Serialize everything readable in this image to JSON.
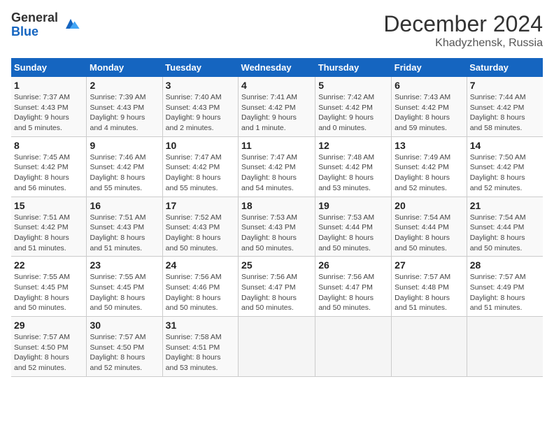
{
  "logo": {
    "general": "General",
    "blue": "Blue"
  },
  "title": "December 2024",
  "subtitle": "Khadyzhensk, Russia",
  "days_of_week": [
    "Sunday",
    "Monday",
    "Tuesday",
    "Wednesday",
    "Thursday",
    "Friday",
    "Saturday"
  ],
  "weeks": [
    [
      {
        "num": "1",
        "info": "Sunrise: 7:37 AM\nSunset: 4:43 PM\nDaylight: 9 hours\nand 5 minutes."
      },
      {
        "num": "2",
        "info": "Sunrise: 7:39 AM\nSunset: 4:43 PM\nDaylight: 9 hours\nand 4 minutes."
      },
      {
        "num": "3",
        "info": "Sunrise: 7:40 AM\nSunset: 4:43 PM\nDaylight: 9 hours\nand 2 minutes."
      },
      {
        "num": "4",
        "info": "Sunrise: 7:41 AM\nSunset: 4:42 PM\nDaylight: 9 hours\nand 1 minute."
      },
      {
        "num": "5",
        "info": "Sunrise: 7:42 AM\nSunset: 4:42 PM\nDaylight: 9 hours\nand 0 minutes."
      },
      {
        "num": "6",
        "info": "Sunrise: 7:43 AM\nSunset: 4:42 PM\nDaylight: 8 hours\nand 59 minutes."
      },
      {
        "num": "7",
        "info": "Sunrise: 7:44 AM\nSunset: 4:42 PM\nDaylight: 8 hours\nand 58 minutes."
      }
    ],
    [
      {
        "num": "8",
        "info": "Sunrise: 7:45 AM\nSunset: 4:42 PM\nDaylight: 8 hours\nand 56 minutes."
      },
      {
        "num": "9",
        "info": "Sunrise: 7:46 AM\nSunset: 4:42 PM\nDaylight: 8 hours\nand 55 minutes."
      },
      {
        "num": "10",
        "info": "Sunrise: 7:47 AM\nSunset: 4:42 PM\nDaylight: 8 hours\nand 55 minutes."
      },
      {
        "num": "11",
        "info": "Sunrise: 7:47 AM\nSunset: 4:42 PM\nDaylight: 8 hours\nand 54 minutes."
      },
      {
        "num": "12",
        "info": "Sunrise: 7:48 AM\nSunset: 4:42 PM\nDaylight: 8 hours\nand 53 minutes."
      },
      {
        "num": "13",
        "info": "Sunrise: 7:49 AM\nSunset: 4:42 PM\nDaylight: 8 hours\nand 52 minutes."
      },
      {
        "num": "14",
        "info": "Sunrise: 7:50 AM\nSunset: 4:42 PM\nDaylight: 8 hours\nand 52 minutes."
      }
    ],
    [
      {
        "num": "15",
        "info": "Sunrise: 7:51 AM\nSunset: 4:42 PM\nDaylight: 8 hours\nand 51 minutes."
      },
      {
        "num": "16",
        "info": "Sunrise: 7:51 AM\nSunset: 4:43 PM\nDaylight: 8 hours\nand 51 minutes."
      },
      {
        "num": "17",
        "info": "Sunrise: 7:52 AM\nSunset: 4:43 PM\nDaylight: 8 hours\nand 50 minutes."
      },
      {
        "num": "18",
        "info": "Sunrise: 7:53 AM\nSunset: 4:43 PM\nDaylight: 8 hours\nand 50 minutes."
      },
      {
        "num": "19",
        "info": "Sunrise: 7:53 AM\nSunset: 4:44 PM\nDaylight: 8 hours\nand 50 minutes."
      },
      {
        "num": "20",
        "info": "Sunrise: 7:54 AM\nSunset: 4:44 PM\nDaylight: 8 hours\nand 50 minutes."
      },
      {
        "num": "21",
        "info": "Sunrise: 7:54 AM\nSunset: 4:44 PM\nDaylight: 8 hours\nand 50 minutes."
      }
    ],
    [
      {
        "num": "22",
        "info": "Sunrise: 7:55 AM\nSunset: 4:45 PM\nDaylight: 8 hours\nand 50 minutes."
      },
      {
        "num": "23",
        "info": "Sunrise: 7:55 AM\nSunset: 4:45 PM\nDaylight: 8 hours\nand 50 minutes."
      },
      {
        "num": "24",
        "info": "Sunrise: 7:56 AM\nSunset: 4:46 PM\nDaylight: 8 hours\nand 50 minutes."
      },
      {
        "num": "25",
        "info": "Sunrise: 7:56 AM\nSunset: 4:47 PM\nDaylight: 8 hours\nand 50 minutes."
      },
      {
        "num": "26",
        "info": "Sunrise: 7:56 AM\nSunset: 4:47 PM\nDaylight: 8 hours\nand 50 minutes."
      },
      {
        "num": "27",
        "info": "Sunrise: 7:57 AM\nSunset: 4:48 PM\nDaylight: 8 hours\nand 51 minutes."
      },
      {
        "num": "28",
        "info": "Sunrise: 7:57 AM\nSunset: 4:49 PM\nDaylight: 8 hours\nand 51 minutes."
      }
    ],
    [
      {
        "num": "29",
        "info": "Sunrise: 7:57 AM\nSunset: 4:50 PM\nDaylight: 8 hours\nand 52 minutes."
      },
      {
        "num": "30",
        "info": "Sunrise: 7:57 AM\nSunset: 4:50 PM\nDaylight: 8 hours\nand 52 minutes."
      },
      {
        "num": "31",
        "info": "Sunrise: 7:58 AM\nSunset: 4:51 PM\nDaylight: 8 hours\nand 53 minutes."
      },
      {
        "num": "",
        "info": ""
      },
      {
        "num": "",
        "info": ""
      },
      {
        "num": "",
        "info": ""
      },
      {
        "num": "",
        "info": ""
      }
    ]
  ]
}
